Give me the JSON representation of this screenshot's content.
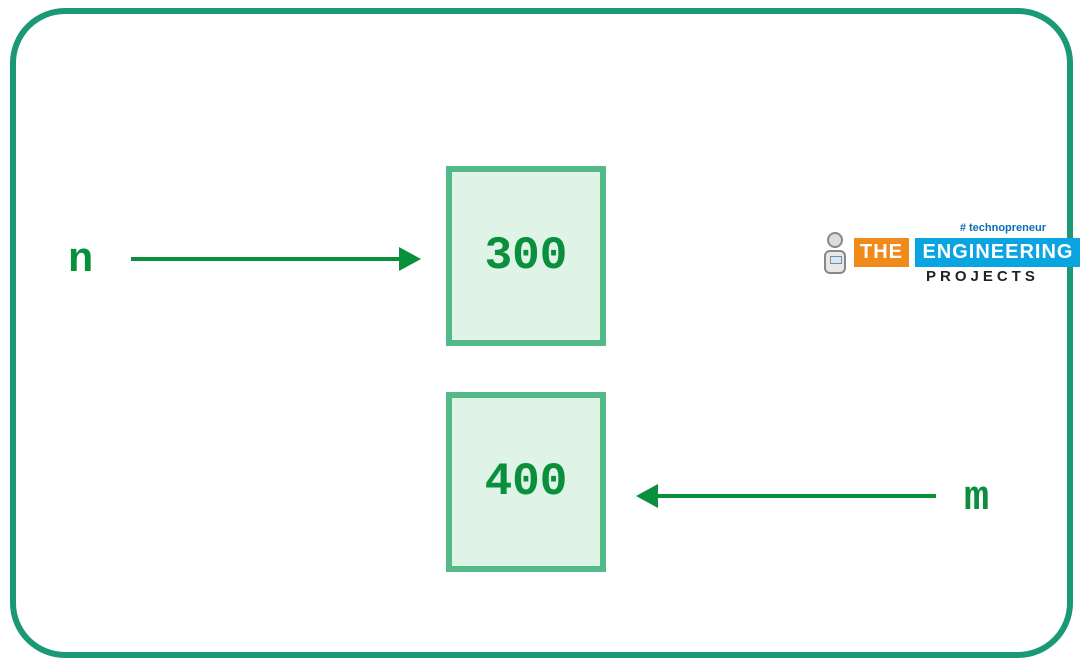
{
  "vars": {
    "n": {
      "label": "n",
      "value": "300"
    },
    "m": {
      "label": "m",
      "value": "400"
    }
  },
  "logo": {
    "hashtag": "# technopreneur",
    "the": "THE",
    "engineering": "ENGINEERING",
    "projects": "PROJECTS"
  }
}
